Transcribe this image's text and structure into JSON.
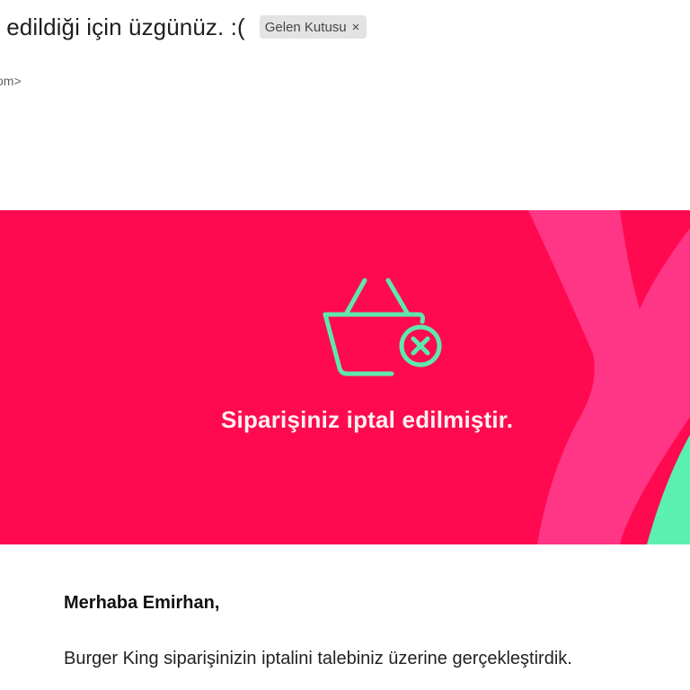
{
  "email": {
    "subject": "l edildiği için üzgünüz. :(",
    "label_chip": "Gelen Kutusu",
    "label_close_glyph": "×",
    "sender_fragment": "om>"
  },
  "banner": {
    "title": "Siparişiniz iptal edilmiştir.",
    "background_color": "#ff0a50",
    "accent_pink": "#ff3586",
    "accent_mint": "#5cf0b0",
    "icon": "shopping-basket-cancel-icon"
  },
  "message": {
    "greeting": "Merhaba Emirhan,",
    "body": "Burger King siparişinizin iptalini talebiniz üzerine gerçekleştirdik."
  }
}
